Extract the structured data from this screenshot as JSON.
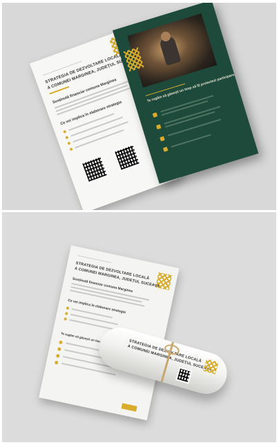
{
  "brochure": {
    "title_line1": "STRATEGIA DE DEZVOLTARE LOCALĂ",
    "title_line2": "A COMUNEI MARGINEA, JUDEȚUL SUCEAVA",
    "heading_1": "Susținută financiar comuna Marginea",
    "heading_2": "Ce vei implica în elaborare strategia",
    "green_heading": "Te rugăm să găsești un timp să îți proiectezi participarea",
    "roll_title_line1": "STRATEGIA DE DEZVOLTARE LOCALĂ",
    "roll_title_line2": "A COMUNEI MARGINEA, JUDEȚUL SUCEAVA"
  },
  "colors": {
    "accent_gold": "#d9ac2b",
    "dark_green": "#1d4a3a",
    "paper": "#f7f7f5"
  },
  "icons": [
    "qr-code-icon",
    "gold-pattern-icon",
    "bullet-icon"
  ]
}
